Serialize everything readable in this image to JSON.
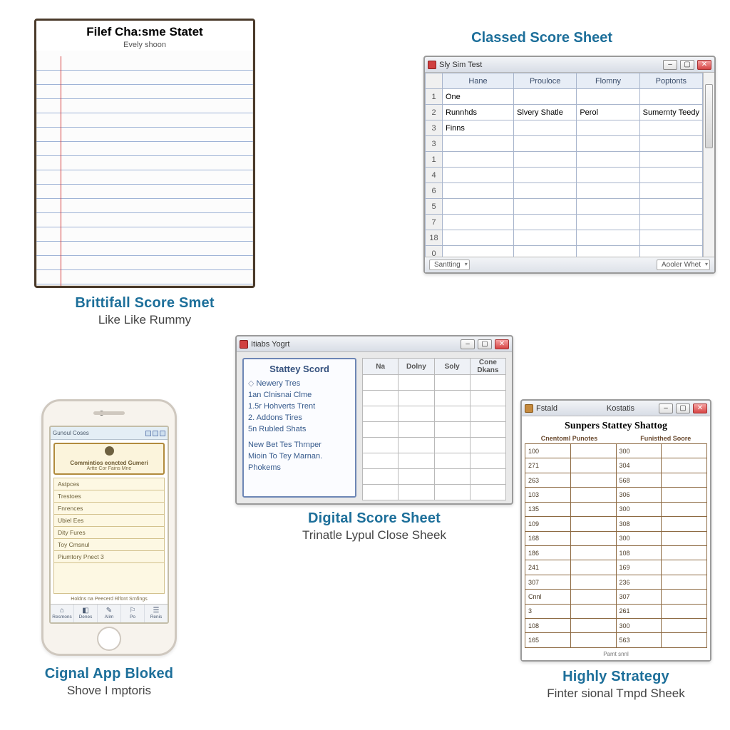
{
  "notepad": {
    "title": "Filef Cha:sme Statet",
    "subtitle": "Evely shoon"
  },
  "notepad_caption": {
    "heading": "Brittifall Score Smet",
    "sub": "Like Like Rummy"
  },
  "tr_heading": "Classed Score Sheet",
  "tr_window": {
    "title": "Sly Sim Test",
    "headers": [
      "",
      "Hane",
      "Prouloce",
      "Flomny",
      "Poptonts"
    ],
    "rows": [
      {
        "n": "1",
        "a": "One",
        "b": "",
        "c": "",
        "d": ""
      },
      {
        "n": "2",
        "a": "Runnhds",
        "b": "Slvery Shatle",
        "c": "Perol",
        "d": "Sumernty Teedy"
      },
      {
        "n": "3",
        "a": "Finns",
        "b": "",
        "c": "",
        "d": ""
      },
      {
        "n": "3",
        "a": "",
        "b": "",
        "c": "",
        "d": ""
      },
      {
        "n": "1",
        "a": "",
        "b": "",
        "c": "",
        "d": ""
      },
      {
        "n": "4",
        "a": "",
        "b": "",
        "c": "",
        "d": ""
      },
      {
        "n": "6",
        "a": "",
        "b": "",
        "c": "",
        "d": ""
      },
      {
        "n": "5",
        "a": "",
        "b": "",
        "c": "",
        "d": ""
      },
      {
        "n": "7",
        "a": "",
        "b": "",
        "c": "",
        "d": ""
      },
      {
        "n": "18",
        "a": "",
        "b": "",
        "c": "",
        "d": ""
      },
      {
        "n": "0",
        "a": "",
        "b": "",
        "c": "",
        "d": ""
      }
    ],
    "status_left": "Santting",
    "status_right": "Aooler Whet"
  },
  "center_window": {
    "title": "Itiabs Yogrt",
    "panel_heading": "Stattey Scord",
    "panel_items": [
      "Newery Tres",
      "1an Clnisnai Clme",
      "1.5r Hohverts Trent",
      "2. Addons Tires",
      "5n Rubled Shats",
      "New Bet Tes Thrnper",
      "Mioin To Tey Marnan.",
      "Phokems"
    ],
    "grid_headers": [
      "Na",
      "Dolny",
      "Soly",
      "Cone Dkans"
    ]
  },
  "center_caption": {
    "heading": "Digital Score Sheet",
    "sub": "Trinatle Lypul Close Sheek"
  },
  "phone": {
    "status_title": "Gunoul Coses",
    "card_heading": "Commintios eoncted Gumeri",
    "card_line": "Artte Cor Fains Mne",
    "list": [
      "Astpces",
      "Trestoes",
      "Fnrences",
      "Ubiel Ees",
      "Dity Fures",
      "Toy Cmsnul",
      "Piumtory   Pnect 3"
    ],
    "footer": "Holdns na Peecerd   Rlfont Srnfings",
    "tabs": [
      "Resmons",
      "Denes",
      "Alim",
      "Po",
      "Renis"
    ]
  },
  "phone_caption": {
    "heading": "Cignal App Bloked",
    "sub": "Shove I mptoris"
  },
  "br_window": {
    "titlebar_left": "Fstald",
    "titlebar_mid": "Kostatis",
    "heading": "Sunpers Stattey Shattog",
    "col_left": "Cnentoml Punotes",
    "col_right": "Funisthed Soore",
    "rows": [
      [
        "100",
        "",
        "300",
        ""
      ],
      [
        "271",
        "",
        "304",
        ""
      ],
      [
        "263",
        "",
        "568",
        ""
      ],
      [
        "103",
        "",
        "306",
        ""
      ],
      [
        "135",
        "",
        "300",
        ""
      ],
      [
        "109",
        "",
        "308",
        ""
      ],
      [
        "168",
        "",
        "300",
        ""
      ],
      [
        "186",
        "",
        "108",
        ""
      ],
      [
        "241",
        "",
        "169",
        ""
      ],
      [
        "307",
        "",
        "236",
        ""
      ],
      [
        "Cnnl",
        "",
        "307",
        ""
      ],
      [
        "3",
        "",
        "261",
        ""
      ],
      [
        "108",
        "",
        "300",
        ""
      ],
      [
        "165",
        "",
        "563",
        ""
      ]
    ],
    "sub": "Pamt snnl"
  },
  "br_caption": {
    "heading": "Highly Strategy",
    "sub": "Finter sional Tmpd Sheek"
  }
}
